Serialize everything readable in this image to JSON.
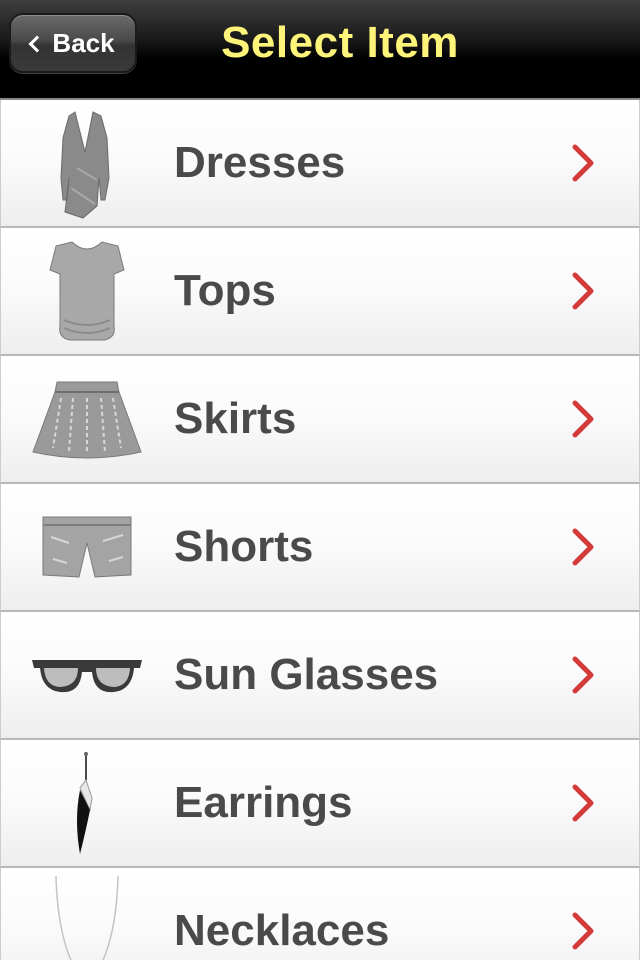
{
  "navbar": {
    "back_label": "Back",
    "title": "Select Item"
  },
  "items": [
    {
      "label": "Dresses",
      "icon": "dress-icon"
    },
    {
      "label": "Tops",
      "icon": "top-icon"
    },
    {
      "label": "Skirts",
      "icon": "skirt-icon"
    },
    {
      "label": "Shorts",
      "icon": "shorts-icon"
    },
    {
      "label": "Sun Glasses",
      "icon": "sunglasses-icon"
    },
    {
      "label": "Earrings",
      "icon": "earring-icon"
    },
    {
      "label": "Necklaces",
      "icon": "necklace-icon"
    }
  ],
  "colors": {
    "title": "#fff47a",
    "label": "#4a4a4a",
    "chevron": "#d33a3a"
  }
}
